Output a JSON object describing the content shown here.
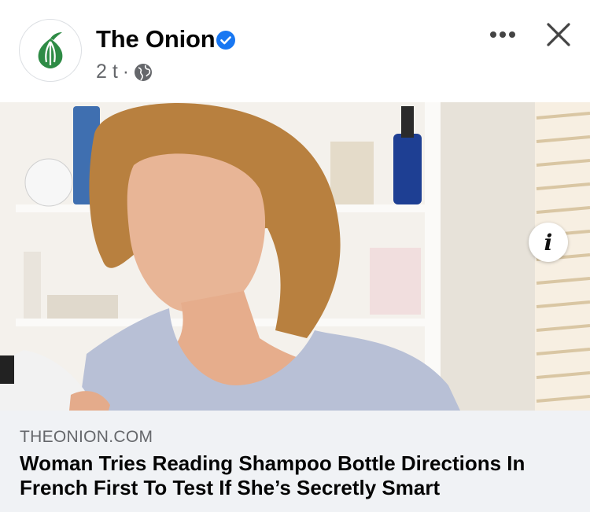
{
  "post": {
    "page_name": "The Onion",
    "time_ago": "2 t",
    "separator": "·",
    "verified_icon": "verified-badge-icon",
    "audience_icon": "globe-icon"
  },
  "actions": {
    "more_icon": "more-dots-icon",
    "close_icon": "close-icon"
  },
  "photo": {
    "info_label": "i"
  },
  "link_preview": {
    "domain": "THEONION.COM",
    "headline": "Woman Tries Reading Shampoo Bottle Directions In French First To Test If She’s Secretly Smart"
  },
  "colors": {
    "brand_green": "#2e8b45",
    "verified_blue": "#1877f2",
    "secondary_text": "#65676b",
    "link_box_bg": "#f0f2f5"
  }
}
